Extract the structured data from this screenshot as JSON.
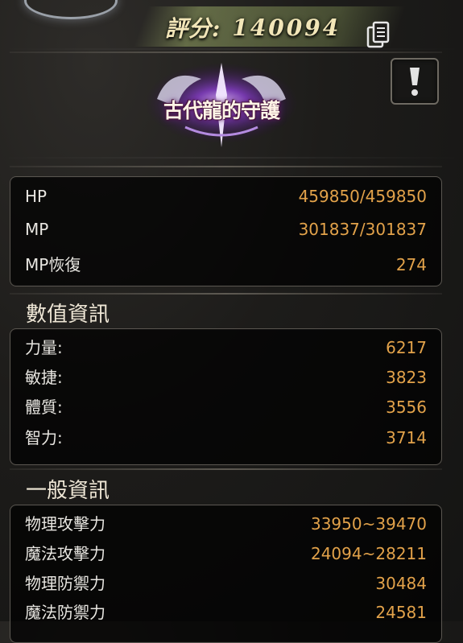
{
  "score": {
    "label": "評分:",
    "value": "140094"
  },
  "title_badge": {
    "text": "古代龍的守護"
  },
  "vitals": [
    {
      "label": "HP",
      "value": "459850/459850"
    },
    {
      "label": "MP",
      "value": "301837/301837"
    },
    {
      "label": "MP恢復",
      "value": "274"
    }
  ],
  "stats_section": {
    "title": "數值資訊",
    "rows": [
      {
        "label": "力量:",
        "value": "6217"
      },
      {
        "label": "敏捷:",
        "value": "3823"
      },
      {
        "label": "體質:",
        "value": "3556"
      },
      {
        "label": "智力:",
        "value": "3714"
      }
    ]
  },
  "general_section": {
    "title": "一般資訊",
    "rows": [
      {
        "label": "物理攻擊力",
        "value": "33950~39470"
      },
      {
        "label": "魔法攻擊力",
        "value": "24094~28211"
      },
      {
        "label": "物理防禦力",
        "value": "30484"
      },
      {
        "label": "魔法防禦力",
        "value": "24581"
      }
    ]
  },
  "colors": {
    "value": "#e2a24a",
    "label": "#e8e6e1",
    "panel_border": "#5a5650"
  },
  "icons": [
    "copy-icon",
    "exclamation-icon"
  ]
}
